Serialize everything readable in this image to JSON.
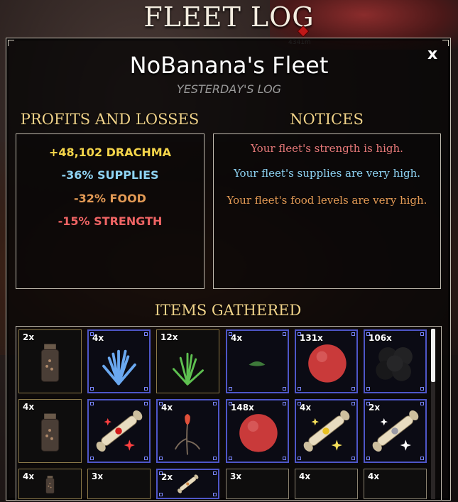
{
  "header": {
    "title": "FLEET LOG",
    "distance": "4341m"
  },
  "log": {
    "fleet_name": "NoBanana's Fleet",
    "subtitle": "YESTERDAY'S LOG",
    "close_label": "x"
  },
  "profits": {
    "title": "PROFITS AND LOSSES",
    "lines": [
      {
        "text": "+48,102 DRACHMA",
        "color": "#f5d54a"
      },
      {
        "text": "-36% SUPPLIES",
        "color": "#8fd4f4"
      },
      {
        "text": "-32% FOOD",
        "color": "#e39a55"
      },
      {
        "text": "-15% STRENGTH",
        "color": "#ef6464"
      }
    ]
  },
  "notices": {
    "title": "NOTICES",
    "items": [
      {
        "text": "Your fleet's strength is high.",
        "color": "#e97a7a"
      },
      {
        "text": "Your fleet's supplies are very high.",
        "color": "#8fd4f4"
      },
      {
        "text": "Your fleet's food levels are very high.",
        "color": "#e39a55"
      }
    ]
  },
  "items": {
    "title": "ITEMS GATHERED",
    "rows": [
      [
        {
          "qty": "2x",
          "icon": "jar-icon",
          "rarity": "common"
        },
        {
          "qty": "4x",
          "icon": "blue-plant-icon",
          "rarity": "rare"
        },
        {
          "qty": "12x",
          "icon": "green-grass-icon",
          "rarity": "common"
        },
        {
          "qty": "4x",
          "icon": "small-plant-icon",
          "rarity": "rare"
        },
        {
          "qty": "131x",
          "icon": "red-orb-icon",
          "rarity": "rare"
        },
        {
          "qty": "106x",
          "icon": "black-orbs-icon",
          "rarity": "rare"
        }
      ],
      [
        {
          "qty": "4x",
          "icon": "jar-icon",
          "rarity": "common"
        },
        {
          "qty": "",
          "icon": "red-scroll-icon",
          "rarity": "rare"
        },
        {
          "qty": "4x",
          "icon": "red-flower-icon",
          "rarity": "rare"
        },
        {
          "qty": "148x",
          "icon": "red-orb-icon",
          "rarity": "rare"
        },
        {
          "qty": "4x",
          "icon": "gold-scroll-icon",
          "rarity": "rare"
        },
        {
          "qty": "2x",
          "icon": "silver-scroll-icon",
          "rarity": "rare"
        }
      ],
      [
        {
          "qty": "4x",
          "icon": "jar-icon",
          "rarity": "common"
        },
        {
          "qty": "3x",
          "icon": "unknown-icon",
          "rarity": "common"
        },
        {
          "qty": "2x",
          "icon": "scroll-icon",
          "rarity": "rare"
        },
        {
          "qty": "3x",
          "icon": "unknown-icon",
          "rarity": "plain"
        },
        {
          "qty": "4x",
          "icon": "unknown-icon",
          "rarity": "plain"
        },
        {
          "qty": "4x",
          "icon": "unknown-icon",
          "rarity": "plain"
        }
      ]
    ]
  }
}
